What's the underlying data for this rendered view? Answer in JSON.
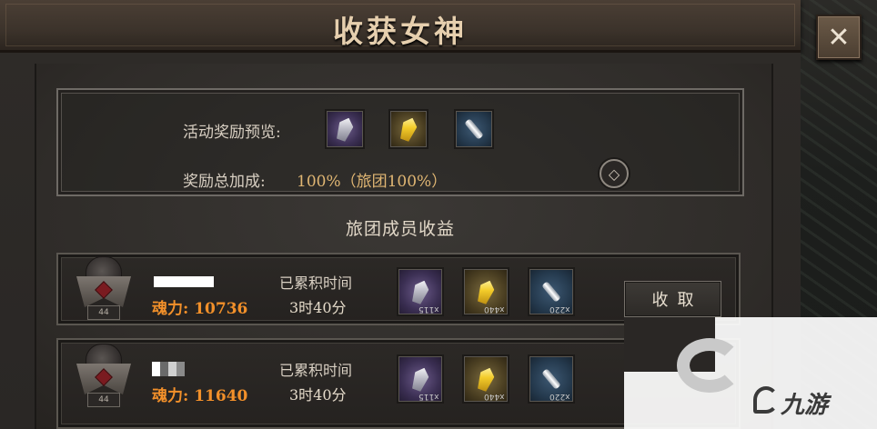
{
  "header": {
    "title": "收获女神"
  },
  "close": {
    "symbol": "✕"
  },
  "preview": {
    "label": "活动奖励预览:",
    "items": [
      {
        "icon": "silver-crystal-icon",
        "rarity": "purple"
      },
      {
        "icon": "gold-crystal-icon",
        "rarity": "gold"
      },
      {
        "icon": "silver-bar-icon",
        "rarity": "blue"
      }
    ],
    "bonus_label": "奖励总加成:",
    "bonus_value": "100%（旅团100%）",
    "help_symbol": "◇"
  },
  "section_title": "旅团成员收益",
  "members": [
    {
      "level": "44",
      "power_label": "魂力:",
      "power_value": "10736",
      "accumulated_label": "已累积时间",
      "accumulated_time": "3时40分",
      "rewards": [
        {
          "icon": "silver-crystal-icon",
          "count": "x115"
        },
        {
          "icon": "gold-crystal-icon",
          "count": "x440"
        },
        {
          "icon": "silver-bar-icon",
          "count": "x220"
        }
      ]
    },
    {
      "level": "44",
      "power_label": "魂力:",
      "power_value": "11640",
      "accumulated_label": "已累积时间",
      "accumulated_time": "3时40分",
      "rewards": [
        {
          "icon": "silver-crystal-icon",
          "count": "x115"
        },
        {
          "icon": "gold-crystal-icon",
          "count": "x440"
        },
        {
          "icon": "silver-bar-icon",
          "count": "x220"
        }
      ]
    }
  ],
  "collect_button": "收取",
  "watermark": {
    "text": "九游"
  },
  "colors": {
    "power": "#f2902a",
    "accent_gold": "#e0b673",
    "title": "#e6cfae"
  }
}
